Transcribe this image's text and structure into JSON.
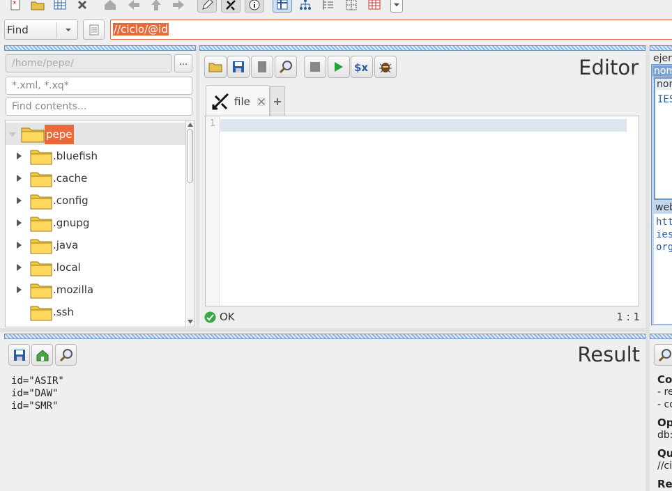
{
  "search": {
    "mode": "Find",
    "query": "//ciclo/@id"
  },
  "filebrowser": {
    "path_placeholder": "/home/pepe/",
    "browse_label": "...",
    "filter_placeholder": "*.xml, *.xq*",
    "contents_placeholder": "Find contents...",
    "root": "pepe",
    "items": [
      ".bluefish",
      ".cache",
      ".config",
      ".gnupg",
      ".java",
      ".local",
      ".mozilla",
      ".ssh"
    ]
  },
  "editor": {
    "title": "Editor",
    "tab_label": "file",
    "line_number": "1",
    "status": "OK",
    "position": "1 : 1"
  },
  "result": {
    "title": "Result",
    "lines": [
      "id=\"ASIR\"",
      "id=\"DAW\"",
      "id=\"SMR\""
    ]
  },
  "right": {
    "top_label": "ejer",
    "sel1": "nom",
    "sel2": "nom",
    "val1": "IES",
    "label2": "web",
    "links": [
      "htt",
      "ies",
      "org"
    ],
    "info_1": "Co",
    "info_2": "- re",
    "info_3": "- co",
    "info_4": "Op",
    "info_5": "db:",
    "info_6": "Qu",
    "info_7": "//ci",
    "info_8": "Re"
  }
}
